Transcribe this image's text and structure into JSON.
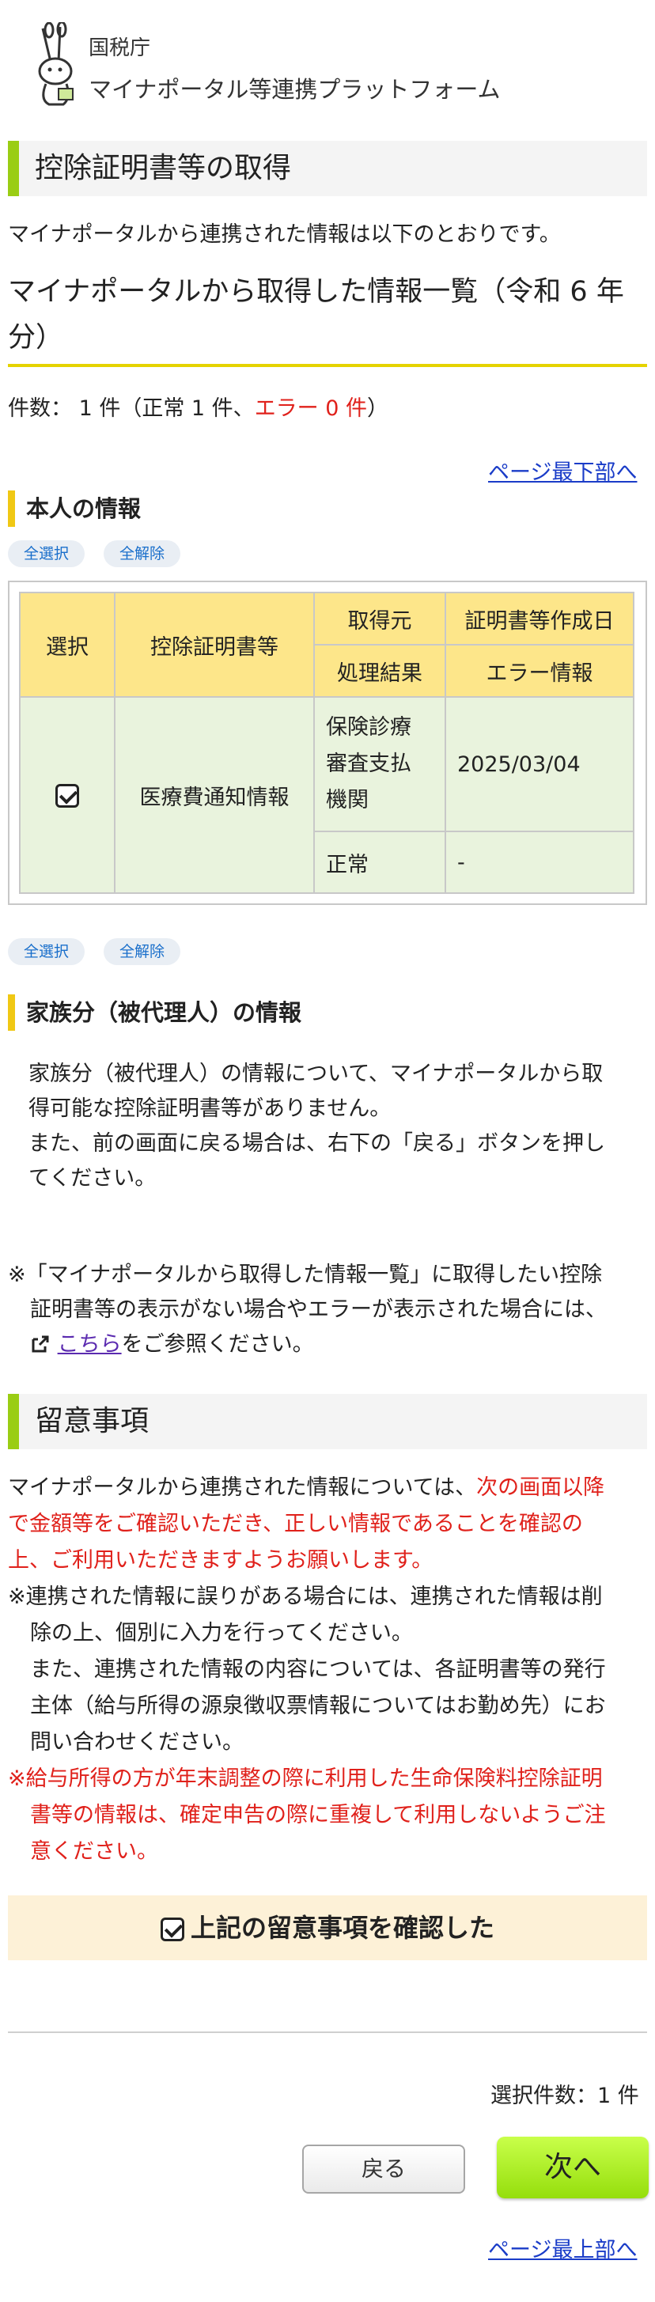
{
  "header": {
    "agency": "国税庁",
    "platform": "マイナポータル等連携プラットフォーム"
  },
  "section1": {
    "title": "控除証明書等の取得",
    "intro": "マイナポータルから連携された情報は以下のとおりです。",
    "list_heading_line1": "マイナポータルから取得した情報一覧（令和 6 年",
    "list_heading_line2": "分）",
    "count_prefix": "件数： 1 件（正常 1 件、",
    "count_error": "エラー 0 件",
    "count_suffix": "）",
    "to_bottom": "ページ最下部へ"
  },
  "self_info": {
    "title": "本人の情報",
    "select_all": "全選択",
    "deselect_all": "全解除",
    "table": {
      "headers": {
        "select": "選択",
        "cert": "控除証明書等",
        "source": "取得元",
        "created": "証明書等作成日",
        "result": "処理結果",
        "error": "エラー情報"
      },
      "row": {
        "checked": true,
        "cert": "医療費通知情報",
        "source_line1": "保険診療",
        "source_line2": "審査支払",
        "source_line3": "機関",
        "created": "2025/03/04",
        "result": "正常",
        "error": "-"
      }
    },
    "select_all_2": "全選択",
    "deselect_all_2": "全解除"
  },
  "family": {
    "title": "家族分（被代理人）の情報",
    "line1": "家族分（被代理人）の情報について、マイナポータルから取",
    "line2": "得可能な控除証明書等がありません。",
    "line3": "また、前の画面に戻る場合は、右下の「戻る」ボタンを押し",
    "line4": "てください。"
  },
  "note": {
    "line1": "※「マイナポータルから取得した情報一覧」に取得したい控除",
    "line2": "証明書等の表示がない場合やエラーが表示された場合には、",
    "link": "こちら",
    "line3_suffix": "をご参照ください。"
  },
  "caution": {
    "title": "留意事項",
    "p1_line1_black": "マイナポータルから連携された情報については、",
    "p1_line1_red": "次の画面以降",
    "p1_line2": "で金額等をご確認いただき、正しい情報であることを確認の",
    "p1_line3": "上、ご利用いただきますようお願いします。",
    "p2_line1": "※連携された情報に誤りがある場合には、連携された情報は削",
    "p2_line2": "除の上、個別に入力を行ってください。",
    "p2_line3": "また、連携された情報の内容については、各証明書等の発行",
    "p2_line4": "主体（給与所得の源泉徴収票情報についてはお勤め先）にお",
    "p2_line5": "問い合わせください。",
    "p3_line1": "※給与所得の方が年末調整の際に利用した生命保険料控除証明",
    "p3_line2": "書等の情報は、確定申告の際に重複して利用しないようご注",
    "p3_line3": "意ください。",
    "confirm_label": "上記の留意事項を確認した",
    "confirm_checked": true
  },
  "footer": {
    "selected_count": "選択件数：1 件",
    "back": "戻る",
    "next": "次へ",
    "to_top": "ページ最上部へ"
  }
}
